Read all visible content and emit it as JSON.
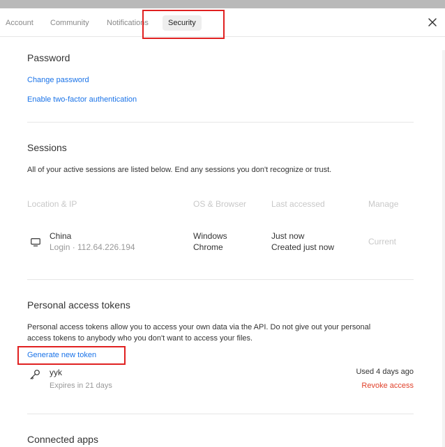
{
  "tabs": [
    {
      "label": "Account"
    },
    {
      "label": "Community"
    },
    {
      "label": "Notifications"
    },
    {
      "label": "Security"
    }
  ],
  "password": {
    "title": "Password",
    "change_link": "Change password",
    "twofa_link": "Enable two-factor authentication"
  },
  "sessions": {
    "title": "Sessions",
    "description": "All of your active sessions are listed below. End any sessions you don't recognize or trust.",
    "columns": [
      "Location & IP",
      "OS & Browser",
      "Last accessed",
      "Manage"
    ],
    "rows": [
      {
        "location": "China",
        "ip": "Login · 112.64.226.194",
        "os": "Windows",
        "browser": "Chrome",
        "last": "Just now",
        "created": "Created just now",
        "manage": "Current"
      }
    ]
  },
  "tokens": {
    "title": "Personal access tokens",
    "description_line1": "Personal access tokens allow you to access your own data via the API. Do not give out your personal",
    "description_line2": "access tokens to anybody who you don't want to access your files.",
    "generate_link": "Generate new token",
    "items": [
      {
        "name": "yyk",
        "expires": "Expires in 21 days",
        "used": "Used 4 days ago",
        "revoke": "Revoke access"
      }
    ]
  },
  "connected": {
    "title": "Connected apps"
  },
  "colors": {
    "link": "#1a73e8",
    "danger": "#e0402a",
    "highlight": "#e02020"
  }
}
